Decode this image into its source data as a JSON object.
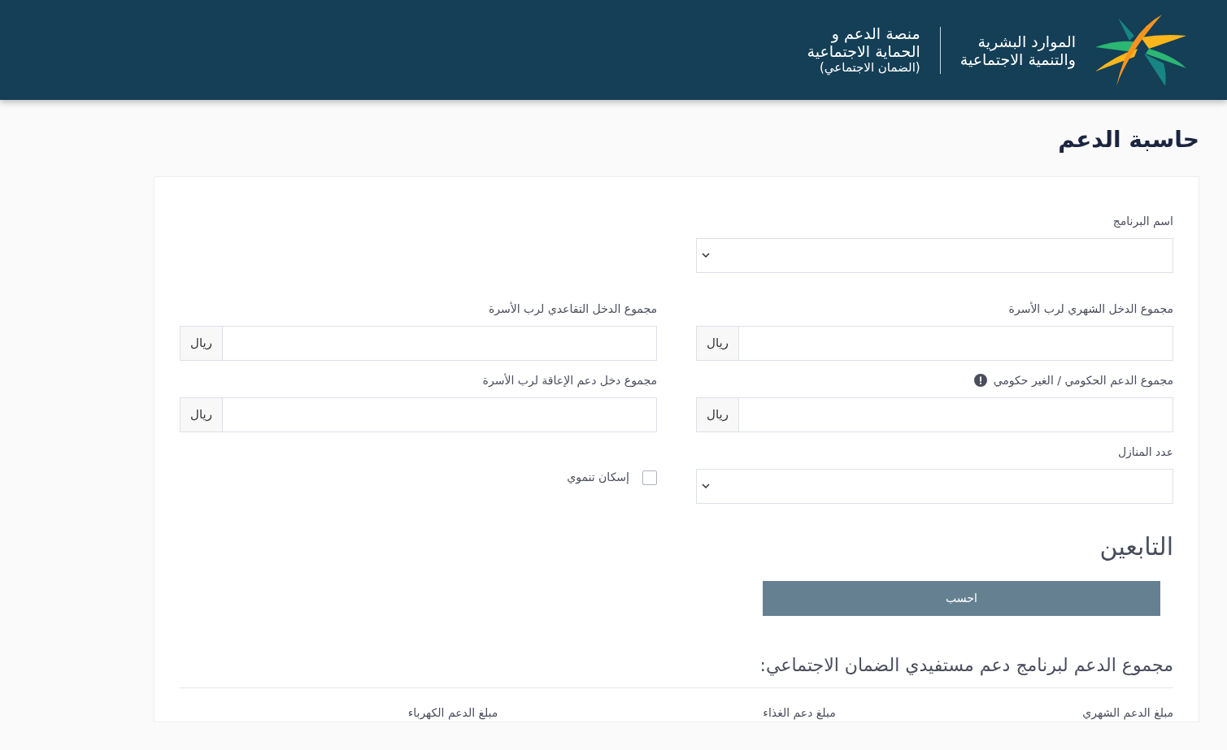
{
  "header": {
    "ministry_lines": [
      "الموارد البشرية",
      "والتنمية الاجتماعية"
    ],
    "platform_lines": [
      "منصة الدعم و",
      "الحماية الاجتماعية",
      "(الضمان الاجتماعي)"
    ]
  },
  "page_title": "حاسبة الدعم",
  "form_rows": [
    [
      {
        "kind": "select",
        "label": "اسم البرنامج"
      }
    ],
    [
      {
        "kind": "currency",
        "label": "مجموع الدخل الشهري لرب الأسرة",
        "unit": "ريال"
      },
      {
        "kind": "currency",
        "label": "مجموع الدخل التقاعدي لرب الأسرة",
        "unit": "ريال"
      }
    ],
    [
      {
        "kind": "currency",
        "label": "مجموع الدعم الحكومي / الغير حكومي",
        "unit": "ريال",
        "info": true
      },
      {
        "kind": "currency",
        "label": "مجموع دخل دعم الإعاقة لرب الأسرة",
        "unit": "ريال"
      }
    ],
    [
      {
        "kind": "select",
        "label": "عدد المنازل"
      },
      {
        "kind": "checkbox",
        "label": "إسكان تنموي",
        "checked": false
      }
    ]
  ],
  "dependents_title": "التابعين",
  "calculate_button": "احسب",
  "summary": {
    "title": "مجموع الدعم لبرنامج دعم مستفيدي الضمان الاجتماعي:",
    "columns": [
      "مبلغ الدعم الشهري",
      "مبلغ دعم الغذاء",
      "مبلغ الدعم الكهرباء"
    ]
  }
}
